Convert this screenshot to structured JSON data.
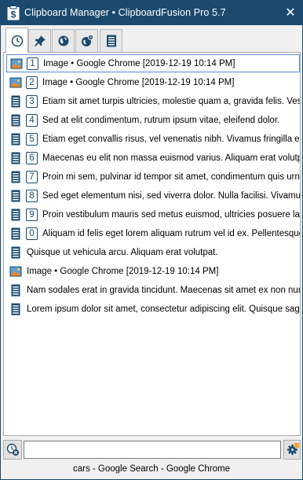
{
  "window": {
    "title": "Clipboard Manager • ClipboardFusion Pro 5.7",
    "close_glyph": "✕"
  },
  "tabs": [
    {
      "name": "history-tab",
      "icon": "clock-icon",
      "active": true
    },
    {
      "name": "pinned-tab",
      "icon": "pin-icon",
      "active": false
    },
    {
      "name": "web-tab",
      "icon": "globe-icon",
      "active": false
    },
    {
      "name": "web-macros-tab",
      "icon": "globe-gear-icon",
      "active": false
    },
    {
      "name": "text-tab",
      "icon": "document-icon",
      "active": false
    }
  ],
  "items": [
    {
      "type": "image",
      "num": "1",
      "text": "Image • Google Chrome [2019-12-19 10:14 PM]"
    },
    {
      "type": "image",
      "num": "2",
      "text": "Image • Google Chrome [2019-12-19 10:14 PM]"
    },
    {
      "type": "text",
      "num": "3",
      "text": "Etiam sit amet turpis ultricies, molestie quam a, gravida felis. Vestibulum"
    },
    {
      "type": "text",
      "num": "4",
      "text": "Sed at elit condimentum, rutrum ipsum vitae, eleifend dolor."
    },
    {
      "type": "text",
      "num": "5",
      "text": "Etiam eget convallis risus, vel venenatis nibh. Vivamus fringilla enim"
    },
    {
      "type": "text",
      "num": "6",
      "text": "Maecenas eu elit non massa euismod varius. Aliquam erat volutpat."
    },
    {
      "type": "text",
      "num": "7",
      "text": "Proin mi sem, pulvinar id tempor sit amet, condimentum quis urna."
    },
    {
      "type": "text",
      "num": "8",
      "text": "Sed eget elementum nisi, sed viverra dolor. Nulla facilisi. Vivamus"
    },
    {
      "type": "text",
      "num": "9",
      "text": "Proin vestibulum mauris sed metus euismod, ultricies posuere lacus"
    },
    {
      "type": "text",
      "num": "0",
      "text": "Aliquam id felis eget lorem aliquam rutrum vel id ex. Pellentesque"
    },
    {
      "type": "text",
      "num": "",
      "text": "Quisque ut vehicula arcu. Aliquam erat volutpat."
    },
    {
      "type": "image",
      "num": "",
      "text": "Image • Google Chrome [2019-12-19 10:14 PM]"
    },
    {
      "type": "text",
      "num": "",
      "text": "Nam sodales erat in gravida tincidunt. Maecenas sit amet ex non nunc"
    },
    {
      "type": "text",
      "num": "",
      "text": "Lorem ipsum dolor sit amet, consectetur adipiscing elit. Quisque sagittis"
    }
  ],
  "search": {
    "value": "",
    "placeholder": ""
  },
  "status": "cars - Google Search - Google Chrome",
  "colors": {
    "titlebar": "#1b4a6e",
    "accent": "#1b4a6e",
    "selection_border": "#5b8bd6"
  }
}
